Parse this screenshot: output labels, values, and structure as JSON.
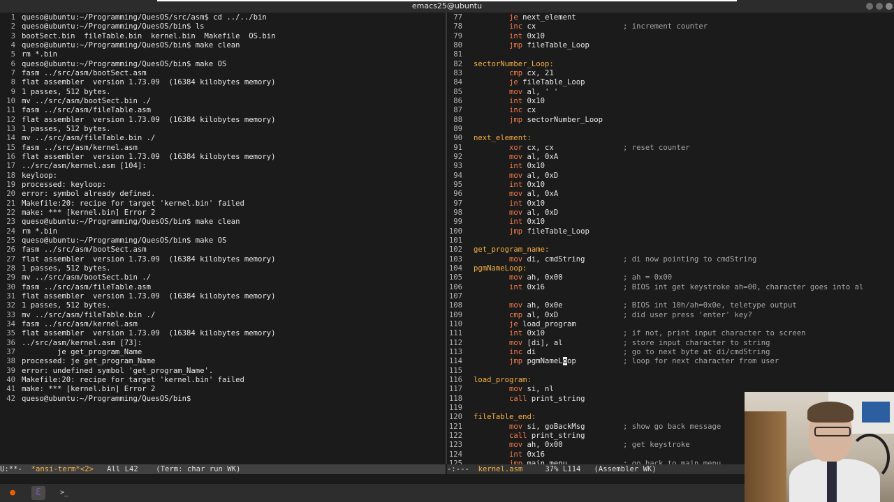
{
  "window": {
    "title": "emacs25@ubuntu"
  },
  "left_pane": {
    "lines": [
      {
        "n": "1",
        "t": "queso@ubuntu:~/Programming/QuesOS/src/asm$ cd ../../bin"
      },
      {
        "n": "2",
        "t": "queso@ubuntu:~/Programming/QuesOS/bin$ ls"
      },
      {
        "n": "3",
        "t": "bootSect.bin  fileTable.bin  kernel.bin  Makefile  OS.bin"
      },
      {
        "n": "4",
        "t": "queso@ubuntu:~/Programming/QuesOS/bin$ make clean"
      },
      {
        "n": "5",
        "t": "rm *.bin"
      },
      {
        "n": "6",
        "t": "queso@ubuntu:~/Programming/QuesOS/bin$ make OS"
      },
      {
        "n": "7",
        "t": "fasm ../src/asm/bootSect.asm"
      },
      {
        "n": "8",
        "t": "flat assembler  version 1.73.09  (16384 kilobytes memory)"
      },
      {
        "n": "9",
        "t": "1 passes, 512 bytes."
      },
      {
        "n": "10",
        "t": "mv ../src/asm/bootSect.bin ./"
      },
      {
        "n": "11",
        "t": "fasm ../src/asm/fileTable.asm"
      },
      {
        "n": "12",
        "t": "flat assembler  version 1.73.09  (16384 kilobytes memory)"
      },
      {
        "n": "13",
        "t": "1 passes, 512 bytes."
      },
      {
        "n": "14",
        "t": "mv ../src/asm/fileTable.bin ./"
      },
      {
        "n": "15",
        "t": "fasm ../src/asm/kernel.asm"
      },
      {
        "n": "16",
        "t": "flat assembler  version 1.73.09  (16384 kilobytes memory)"
      },
      {
        "n": "17",
        "t": "../src/asm/kernel.asm [104]:"
      },
      {
        "n": "18",
        "t": "keyloop:"
      },
      {
        "n": "19",
        "t": "processed: keyloop:"
      },
      {
        "n": "20",
        "t": "error: symbol already defined."
      },
      {
        "n": "21",
        "t": "Makefile:20: recipe for target 'kernel.bin' failed"
      },
      {
        "n": "22",
        "t": "make: *** [kernel.bin] Error 2"
      },
      {
        "n": "23",
        "t": "queso@ubuntu:~/Programming/QuesOS/bin$ make clean"
      },
      {
        "n": "24",
        "t": "rm *.bin"
      },
      {
        "n": "25",
        "t": "queso@ubuntu:~/Programming/QuesOS/bin$ make OS"
      },
      {
        "n": "26",
        "t": "fasm ../src/asm/bootSect.asm"
      },
      {
        "n": "27",
        "t": "flat assembler  version 1.73.09  (16384 kilobytes memory)"
      },
      {
        "n": "28",
        "t": "1 passes, 512 bytes."
      },
      {
        "n": "29",
        "t": "mv ../src/asm/bootSect.bin ./"
      },
      {
        "n": "30",
        "t": "fasm ../src/asm/fileTable.asm"
      },
      {
        "n": "31",
        "t": "flat assembler  version 1.73.09  (16384 kilobytes memory)"
      },
      {
        "n": "32",
        "t": "1 passes, 512 bytes."
      },
      {
        "n": "33",
        "t": "mv ../src/asm/fileTable.bin ./"
      },
      {
        "n": "34",
        "t": "fasm ../src/asm/kernel.asm"
      },
      {
        "n": "35",
        "t": "flat assembler  version 1.73.09  (16384 kilobytes memory)"
      },
      {
        "n": "36",
        "t": "../src/asm/kernel.asm [73]:"
      },
      {
        "n": "37",
        "t": "        je get_program_Name"
      },
      {
        "n": "38",
        "t": "processed: je get_program_Name"
      },
      {
        "n": "39",
        "t": "error: undefined symbol 'get_program_Name'."
      },
      {
        "n": "40",
        "t": "Makefile:20: recipe for target 'kernel.bin' failed"
      },
      {
        "n": "41",
        "t": "make: *** [kernel.bin] Error 2"
      },
      {
        "n": "42",
        "t": "queso@ubuntu:~/Programming/QuesOS/bin$"
      }
    ]
  },
  "right_pane": {
    "lines": [
      {
        "n": "77",
        "i": "        ",
        "k": "je",
        "a": " next_element",
        "c": ""
      },
      {
        "n": "78",
        "i": "        ",
        "k": "inc",
        "a": " cx",
        "c": "; increment counter"
      },
      {
        "n": "79",
        "i": "        ",
        "k": "int",
        "a": " 0x10",
        "c": ""
      },
      {
        "n": "80",
        "i": "        ",
        "k": "jmp",
        "a": " fileTable_Loop",
        "c": ""
      },
      {
        "n": "81",
        "l": "",
        "c": ""
      },
      {
        "n": "82",
        "l": "sectorNumber_Loop:",
        "c": ""
      },
      {
        "n": "83",
        "i": "        ",
        "k": "cmp",
        "a": " cx, 21",
        "c": ""
      },
      {
        "n": "84",
        "i": "        ",
        "k": "je",
        "a": " fileTable_Loop",
        "c": ""
      },
      {
        "n": "85",
        "i": "        ",
        "k": "mov",
        "a": " al, ' '",
        "c": ""
      },
      {
        "n": "86",
        "i": "        ",
        "k": "int",
        "a": " 0x10",
        "c": ""
      },
      {
        "n": "87",
        "i": "        ",
        "k": "inc",
        "a": " cx",
        "c": ""
      },
      {
        "n": "88",
        "i": "        ",
        "k": "jmp",
        "a": " sectorNumber_Loop",
        "c": ""
      },
      {
        "n": "89",
        "l": "",
        "c": ""
      },
      {
        "n": "90",
        "l": "next_element:",
        "c": ""
      },
      {
        "n": "91",
        "i": "        ",
        "k": "xor",
        "a": " cx, cx",
        "c": "; reset counter"
      },
      {
        "n": "92",
        "i": "        ",
        "k": "mov",
        "a": " al, 0xA",
        "c": ""
      },
      {
        "n": "93",
        "i": "        ",
        "k": "int",
        "a": " 0x10",
        "c": ""
      },
      {
        "n": "94",
        "i": "        ",
        "k": "mov",
        "a": " al, 0xD",
        "c": ""
      },
      {
        "n": "95",
        "i": "        ",
        "k": "int",
        "a": " 0x10",
        "c": ""
      },
      {
        "n": "96",
        "i": "        ",
        "k": "mov",
        "a": " al, 0xA",
        "c": ""
      },
      {
        "n": "97",
        "i": "        ",
        "k": "int",
        "a": " 0x10",
        "c": ""
      },
      {
        "n": "98",
        "i": "        ",
        "k": "mov",
        "a": " al, 0xD",
        "c": ""
      },
      {
        "n": "99",
        "i": "        ",
        "k": "int",
        "a": " 0x10",
        "c": ""
      },
      {
        "n": "100",
        "i": "        ",
        "k": "jmp",
        "a": " fileTable_Loop",
        "c": ""
      },
      {
        "n": "101",
        "l": "",
        "c": ""
      },
      {
        "n": "102",
        "l": "get_program_name:",
        "c": ""
      },
      {
        "n": "103",
        "i": "        ",
        "k": "mov",
        "a": " di, cmdString",
        "c": "; di now pointing to cmdString"
      },
      {
        "n": "104",
        "l": "pgmNameLoop:",
        "c": ""
      },
      {
        "n": "105",
        "i": "        ",
        "k": "mov",
        "a": " ah, 0x00",
        "c": "; ah = 0x00"
      },
      {
        "n": "106",
        "i": "        ",
        "k": "int",
        "a": " 0x16",
        "c": "; BIOS int get keystroke ah=00, character goes into al"
      },
      {
        "n": "107",
        "l": "",
        "c": ""
      },
      {
        "n": "108",
        "i": "        ",
        "k": "mov",
        "a": " ah, 0x0e",
        "c": "; BIOS int 10h/ah=0x0e, teletype output"
      },
      {
        "n": "109",
        "i": "        ",
        "k": "cmp",
        "a": " al, 0xD",
        "c": "; did user press 'enter' key?"
      },
      {
        "n": "110",
        "i": "        ",
        "k": "je",
        "a": " load_program",
        "c": ""
      },
      {
        "n": "111",
        "i": "        ",
        "k": "int",
        "a": " 0x10",
        "c": "; if not, print input character to screen"
      },
      {
        "n": "112",
        "i": "        ",
        "k": "mov",
        "a": " [di], al",
        "c": "; store input character to string"
      },
      {
        "n": "113",
        "i": "        ",
        "k": "inc",
        "a": " di",
        "c": "; go to next byte at di/cmdString"
      },
      {
        "n": "114",
        "i": "        ",
        "k": "jmp",
        "a": " pgmNameL",
        "cur": "o",
        "a2": "op",
        "c": "; loop for next character from user"
      },
      {
        "n": "115",
        "l": "",
        "c": ""
      },
      {
        "n": "116",
        "l": "load_program:",
        "c": ""
      },
      {
        "n": "117",
        "i": "        ",
        "k": "mov",
        "a": " si, nl",
        "c": ""
      },
      {
        "n": "118",
        "i": "        ",
        "k": "call",
        "a": " print_string",
        "c": ""
      },
      {
        "n": "119",
        "l": "",
        "c": ""
      },
      {
        "n": "120",
        "l": "fileTable_end:",
        "c": ""
      },
      {
        "n": "121",
        "i": "        ",
        "k": "mov",
        "a": " si, goBackMsg",
        "c": "; show go back message"
      },
      {
        "n": "122",
        "i": "        ",
        "k": "call",
        "a": " print_string",
        "c": ""
      },
      {
        "n": "123",
        "i": "        ",
        "k": "mov",
        "a": " ah, 0x00",
        "c": "; get keystroke"
      },
      {
        "n": "124",
        "i": "        ",
        "k": "int",
        "a": " 0x16",
        "c": ""
      },
      {
        "n": "125",
        "i": "        ",
        "k": "jmp",
        "a": " main_menu",
        "c": "; go back to main menu"
      }
    ]
  },
  "modeline_left": {
    "prefix": "U:**-  ",
    "buffer": "*ansi-term*<2>",
    "rest": "   All L42    (Term: char run WK)"
  },
  "modeline_right": {
    "prefix": "-:---  ",
    "buffer": "kernel.asm",
    "rest": "     37% L114   (Assembler WK)"
  },
  "taskbar": {
    "icons": [
      {
        "name": "firefox-icon",
        "glyph": "●",
        "color": "#e66000"
      },
      {
        "name": "emacs-icon",
        "glyph": "Ɛ",
        "color": "#7f5ab6"
      },
      {
        "name": "terminal-icon",
        "glyph": ">_",
        "color": "#dddddd"
      }
    ]
  },
  "colors": {
    "keyword": "#f57b4d",
    "label": "#f6b045",
    "comment": "#a6a6a6",
    "text": "#e8e8e8",
    "background": "#1b1b1b"
  }
}
